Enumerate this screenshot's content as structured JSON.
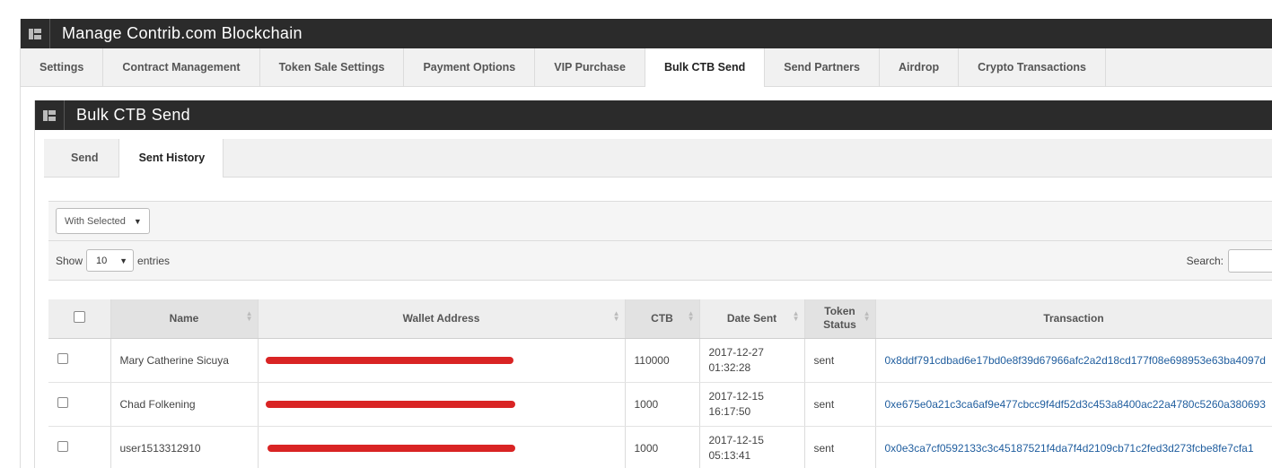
{
  "header": {
    "title": "Manage Contrib.com Blockchain",
    "icon": "grid-icon"
  },
  "main_tabs": [
    {
      "label": "Settings",
      "active": false
    },
    {
      "label": "Contract Management",
      "active": false
    },
    {
      "label": "Token Sale Settings",
      "active": false
    },
    {
      "label": "Payment Options",
      "active": false
    },
    {
      "label": "VIP Purchase",
      "active": false
    },
    {
      "label": "Bulk CTB Send",
      "active": true
    },
    {
      "label": "Send Partners",
      "active": false
    },
    {
      "label": "Airdrop",
      "active": false
    },
    {
      "label": "Crypto Transactions",
      "active": false
    }
  ],
  "panel": {
    "title": "Bulk CTB Send",
    "icon": "grid-icon"
  },
  "sub_tabs": [
    {
      "label": "Send",
      "active": false
    },
    {
      "label": "Sent History",
      "active": true
    }
  ],
  "bulk_action": {
    "selected": "With Selected"
  },
  "length_menu": {
    "show_label": "Show",
    "value": "10",
    "entries_label": "entries"
  },
  "search": {
    "label": "Search:",
    "value": ""
  },
  "table": {
    "columns": [
      "Name",
      "Wallet Address",
      "CTB",
      "Date Sent",
      "Token Status",
      "Transaction"
    ],
    "rows": [
      {
        "name": "Mary Catherine Sicuya",
        "wallet": "[redacted]",
        "ctb": "110000",
        "date": "2017-12-27",
        "time": "01:32:28",
        "status": "sent",
        "tx": "0x8ddf791cdbad6e17bd0e8f39d67966afc2a2d18cd177f08e698953e63ba4097d"
      },
      {
        "name": "Chad Folkening",
        "wallet": "[redacted]",
        "ctb": "1000",
        "date": "2017-12-15",
        "time": "16:17:50",
        "status": "sent",
        "tx": "0xe675e0a21c3ca6af9e477cbcc9f4df52d3c453a8400ac22a4780c5260a380693"
      },
      {
        "name": "user1513312910",
        "wallet": "[redacted]",
        "ctb": "1000",
        "date": "2017-12-15",
        "time": "05:13:41",
        "status": "sent",
        "tx": "0x0e3ca7cf0592133c3c45187521f4da7f4d2109cb71c2fed3d273fcbe8fe7cfa1"
      }
    ]
  },
  "colors": {
    "title_bar": "#2b2b2b",
    "link": "#1f5d9e",
    "redaction": "#d92424"
  }
}
